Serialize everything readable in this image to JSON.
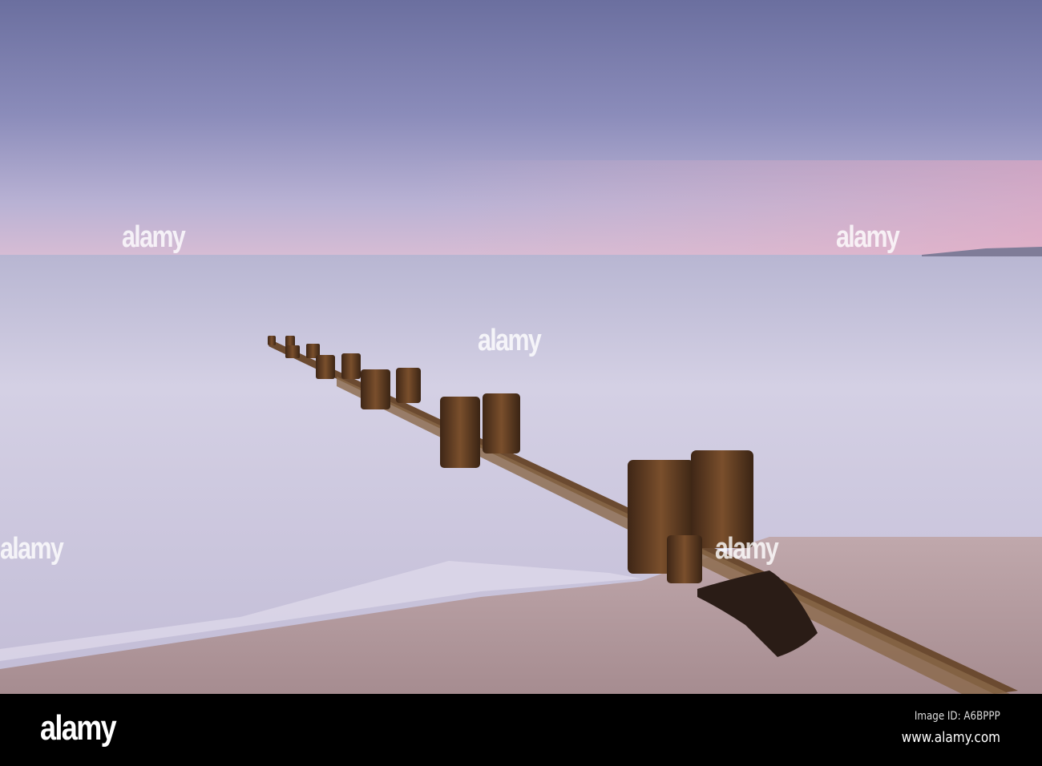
{
  "watermark": {
    "text": "alamy"
  },
  "footer": {
    "logo": "alamy",
    "image_id": "Image ID: A6BPPP",
    "url": "www.alamy.com"
  },
  "colors": {
    "sky_top": "#6b6f9f",
    "sky_horizon": "#d2b8d2",
    "sea": "#c6c2da",
    "sand": "#b49c9f",
    "wood": "#5a3a22"
  }
}
